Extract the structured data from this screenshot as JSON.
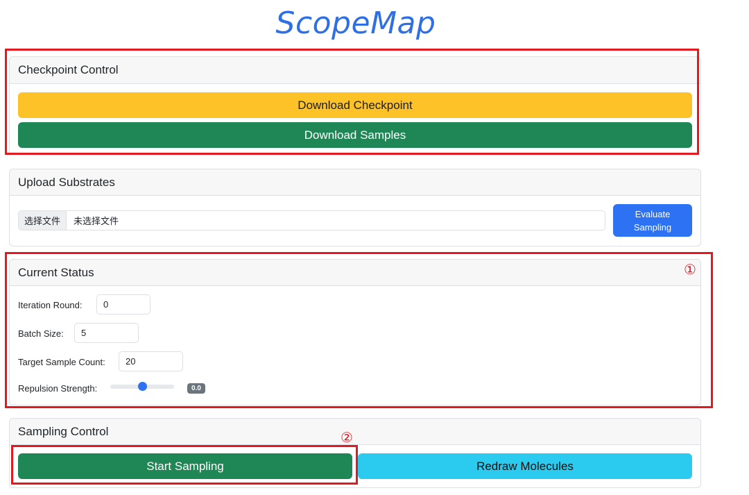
{
  "app": {
    "title": "ScopeMap"
  },
  "checkpoint": {
    "header": "Checkpoint Control",
    "download_checkpoint": "Download Checkpoint",
    "download_samples": "Download Samples"
  },
  "upload": {
    "header": "Upload Substrates",
    "choose_file": "选择文件",
    "no_file": "未选择文件",
    "evaluate": "Evaluate Sampling"
  },
  "status": {
    "header": "Current Status",
    "iteration_label": "Iteration Round:",
    "iteration_value": "0",
    "batch_label": "Batch Size:",
    "batch_value": "5",
    "target_label": "Target Sample Count:",
    "target_value": "20",
    "repulsion_label": "Repulsion Strength:",
    "repulsion_value": "0.0",
    "repulsion_slider_fraction": 0.5
  },
  "sampling": {
    "header": "Sampling Control",
    "start": "Start Sampling",
    "redraw": "Redraw Molecules"
  },
  "annotations": {
    "marker1": "①",
    "marker2": "②",
    "color": "#e3191f"
  },
  "colors": {
    "warning": "#fcc227",
    "success": "#1f8655",
    "info": "#2bcbef",
    "primary": "#2e72f4",
    "title": "#2f6fe4"
  }
}
